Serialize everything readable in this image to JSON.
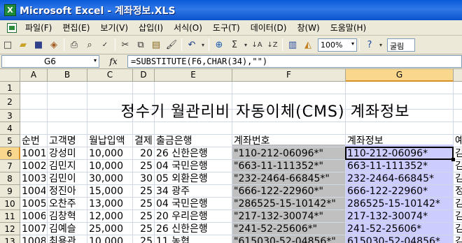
{
  "window": {
    "app_icon": "X",
    "title": "Microsoft Excel - 계좌정보.XLS"
  },
  "menu": {
    "items": [
      "파일(F)",
      "편집(E)",
      "보기(V)",
      "삽입(I)",
      "서식(O)",
      "도구(T)",
      "데이터(D)",
      "창(W)",
      "도움말(H)"
    ]
  },
  "toolbar": {
    "icons": [
      "new-document-icon",
      "open-folder-icon",
      "save-icon",
      "permission-icon",
      "print-icon",
      "print-preview-icon",
      "spelling-icon",
      "cut-icon",
      "copy-icon",
      "paste-icon",
      "format-painter-icon",
      "undo-icon",
      "hyperlink-icon",
      "autosum-icon",
      "sort-ascending-icon",
      "sort-descending-icon",
      "chart-wizard-icon",
      "drawing-icon"
    ],
    "zoom": "100%",
    "font": "굴림"
  },
  "formula_bar": {
    "name_box": "G6",
    "fx": "fx",
    "formula": "=SUBSTITUTE(F6,CHAR(34),\"\")"
  },
  "columns": [
    "A",
    "B",
    "C",
    "D",
    "E",
    "F",
    "G"
  ],
  "rows": [
    "1",
    "2",
    "3",
    "4",
    "5",
    "6",
    "7",
    "8",
    "9",
    "10",
    "11",
    "12",
    "13"
  ],
  "active": {
    "col": "G",
    "row": "6"
  },
  "sheet_title": "정수기 월관리비 자동이체(CMS) 계좌정보",
  "headers": {
    "A": "순번",
    "B": "고객명",
    "C": "월납입액",
    "D": "결제",
    "E": "출금은행",
    "F": "계좌번호",
    "G": "계좌정보",
    "H": "예"
  },
  "records": [
    {
      "A": "1001",
      "B": "강성미",
      "C": "10,000",
      "D": "20",
      "E": "26 신한은행",
      "F": "\"110-212-06096*\"",
      "G": "110-212-06096*"
    },
    {
      "A": "1002",
      "B": "김민지",
      "C": "10,000",
      "D": "25",
      "E": "04 국민은행",
      "F": "\"663-11-111352*\"",
      "G": "663-11-111352*"
    },
    {
      "A": "1003",
      "B": "김민이",
      "C": "30,000",
      "D": "30",
      "E": "05 외환은행",
      "F": "\"232-2464-66845*\"",
      "G": "232-2464-66845*"
    },
    {
      "A": "1004",
      "B": "정진아",
      "C": "15,000",
      "D": "25",
      "E": "34 광주",
      "F": "\"666-122-22960*\"",
      "G": "666-122-22960*"
    },
    {
      "A": "1005",
      "B": "오찬주",
      "C": "13,000",
      "D": "25",
      "E": "04 국민은행",
      "F": "\"286525-15-10142*\"",
      "G": "286525-15-10142*"
    },
    {
      "A": "1006",
      "B": "김창혁",
      "C": "12,000",
      "D": "25",
      "E": "20 우리은행",
      "F": "\"217-132-30074*\"",
      "G": "217-132-30074*"
    },
    {
      "A": "1007",
      "B": "김예슬",
      "C": "25,000",
      "D": "25",
      "E": "26 신한은행",
      "F": "\"241-52-25606*\"",
      "G": "241-52-25606*"
    },
    {
      "A": "1008",
      "B": "최용관",
      "C": "10,000",
      "D": "25",
      "E": "11 농협",
      "F": "\"615030-52-04856*\"",
      "G": "615030-52-04856*"
    }
  ],
  "col_h_partial": [
    "김",
    "김",
    "김",
    "정",
    "김",
    "김",
    "김",
    "김"
  ],
  "colors": {
    "f_fill": "#c0c0c0",
    "g_fill": "#ccccff",
    "selection_header": "#f9d78c",
    "titlebar": "#0a5ad8"
  }
}
